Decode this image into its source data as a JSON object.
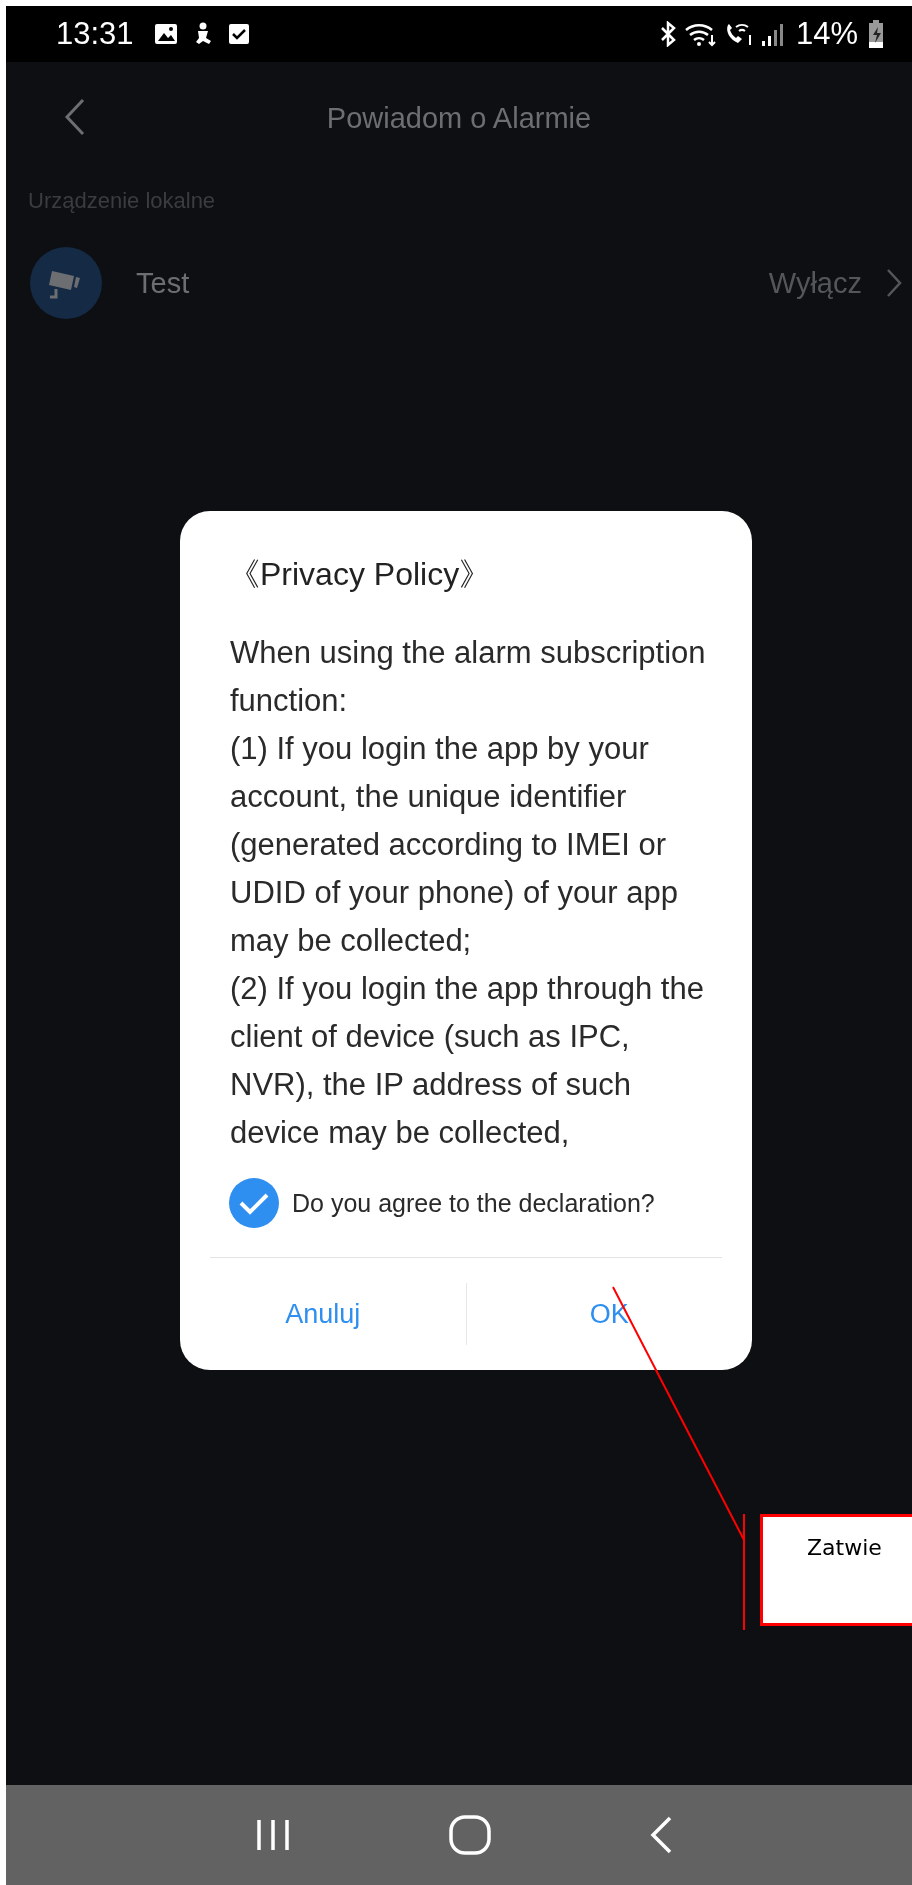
{
  "status_bar": {
    "time": "13:31",
    "battery": "14%"
  },
  "header": {
    "title": "Powiadom o Alarmie"
  },
  "section": {
    "label": "Urządzenie lokalne"
  },
  "devices": [
    {
      "name": "Test",
      "status": "Wyłącz"
    }
  ],
  "dialog": {
    "title": "《Privacy Policy》",
    "body": [
      "When using the alarm subscription function:",
      "(1) If you login the app by your account, the unique identifier (generated according to IMEI or UDID of your phone) of your app may be collected;",
      "(2) If you login the app through the client of device (such as IPC, NVR), the IP address of such device may be collected,"
    ],
    "agree": {
      "label": "Do you agree to the declaration?",
      "checked": true
    },
    "buttons": [
      "Anuluj",
      "OK"
    ]
  },
  "annotation": {
    "text": "Zatwie"
  }
}
